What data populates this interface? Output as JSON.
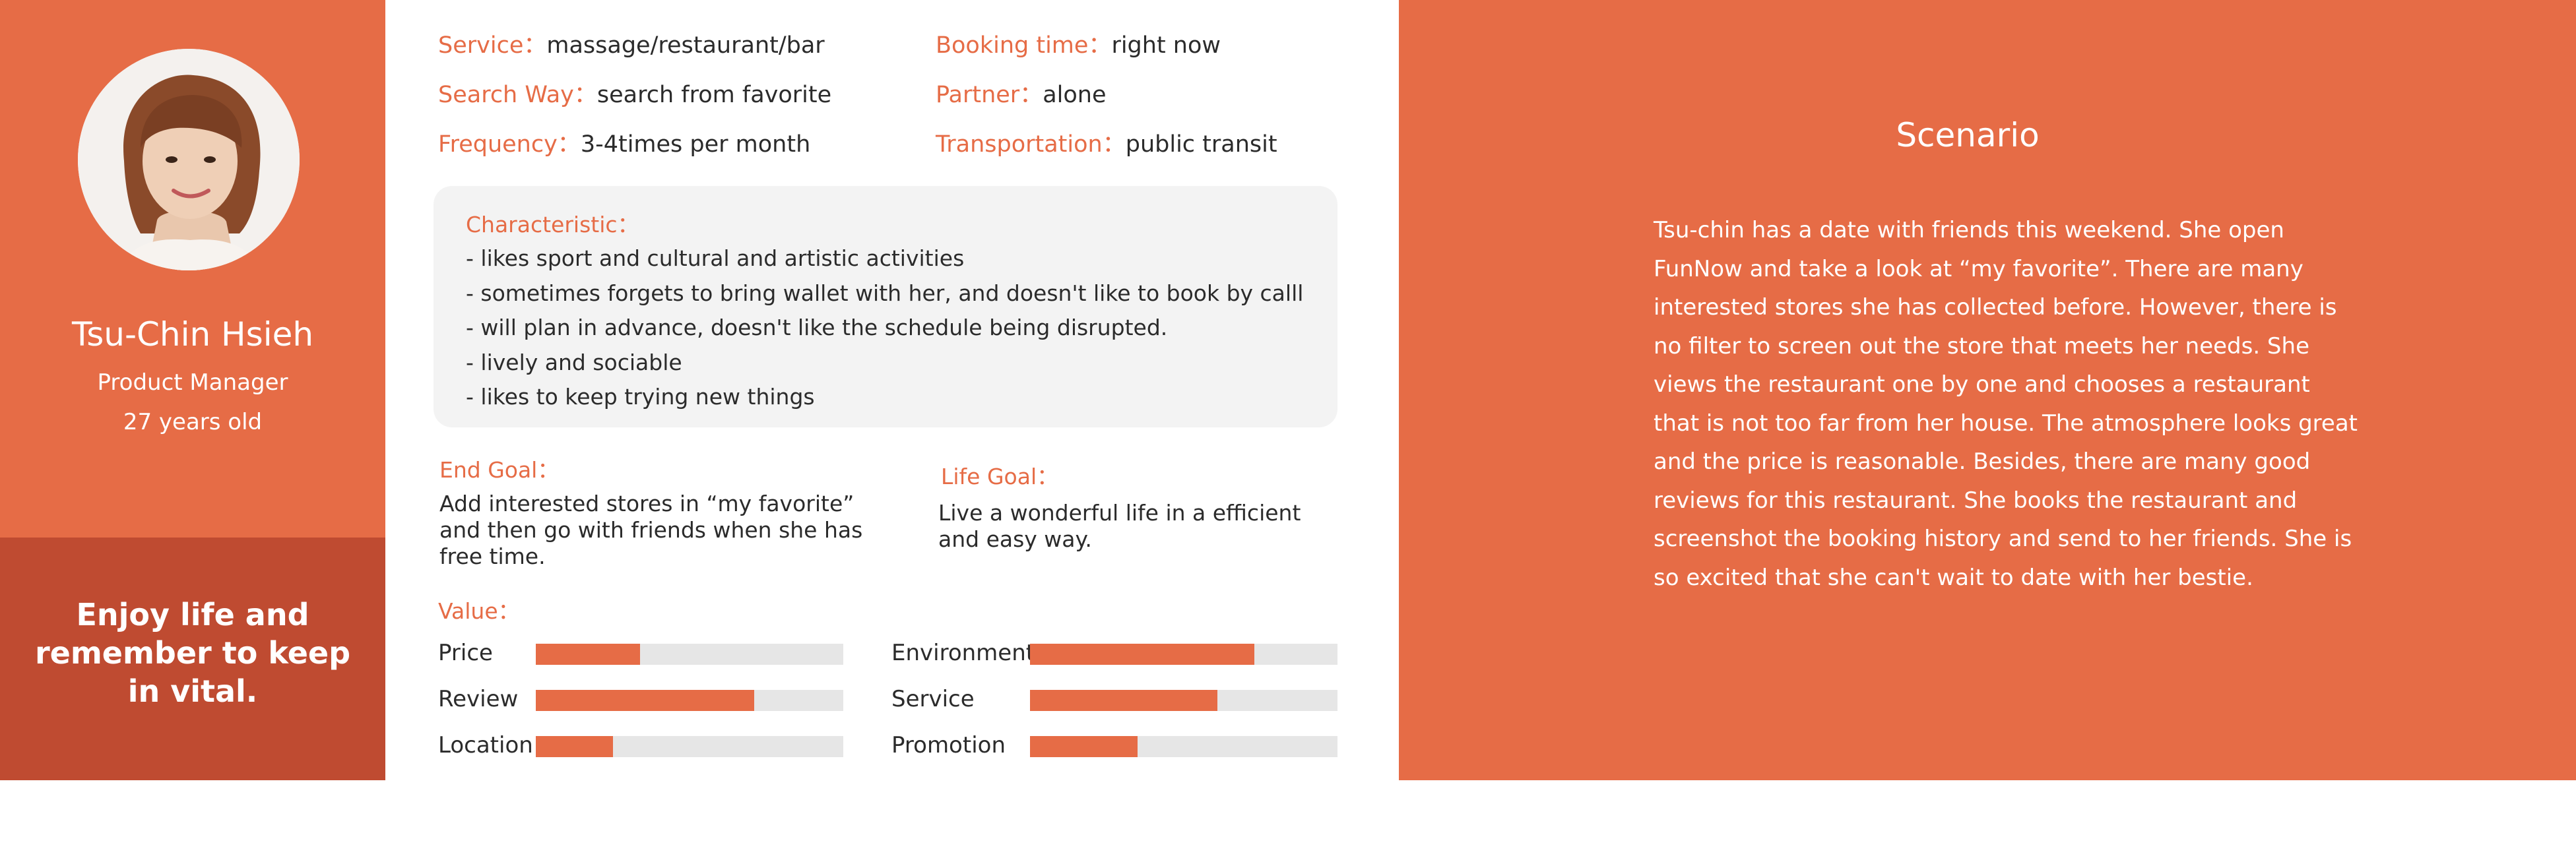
{
  "persona": {
    "name": "Tsu-Chin Hsieh",
    "role": "Product Manager",
    "age": "27 years old",
    "avatar_icon": "portrait-photo",
    "motto": "Enjoy life and remember to keep in vital."
  },
  "details": {
    "service": {
      "label": "Service：",
      "value": "massage/restaurant/bar"
    },
    "search_way": {
      "label": "Search Way：",
      "value": "search from favorite"
    },
    "frequency": {
      "label": "Frequency：",
      "value": "3-4times per month"
    },
    "booking_time": {
      "label": "Booking time：",
      "value": "right now"
    },
    "partner": {
      "label": "Partner：",
      "value": "alone"
    },
    "transportation": {
      "label": "Transportation：",
      "value": "public transit"
    }
  },
  "characteristic": {
    "title": "Characteristic：",
    "items": [
      "- likes sport and cultural and artistic activities",
      "- sometimes forgets to bring wallet with her, and doesn't like to book by calll",
      "- will plan in advance, doesn't like the schedule being disrupted.",
      "- lively and sociable",
      "- likes to keep trying new things"
    ]
  },
  "goals": {
    "end_goal": {
      "title": "End Goal：",
      "text": "Add interested stores in “my favorite” and then go with friends when she has free time."
    },
    "life_goal": {
      "title": "Life Goal：",
      "text": "Live a wonderful life in a efficient and easy way."
    }
  },
  "values": {
    "title": "Value：",
    "metrics": [
      {
        "label": "Price",
        "level": 0.34
      },
      {
        "label": "Review",
        "level": 0.71
      },
      {
        "label": "Location",
        "level": 0.25
      },
      {
        "label": "Environment",
        "level": 0.73
      },
      {
        "label": "Service",
        "level": 0.61
      },
      {
        "label": "Promotion",
        "level": 0.35
      }
    ]
  },
  "scenario": {
    "title": "Scenario",
    "text": "Tsu-chin has a date with friends this weekend. She open FunNow and take a look at “my favorite”. There are many interested stores she has collected before. However, there is no filter to screen out the store that meets her needs. She views the restaurant one by one and chooses a restaurant that is not too far from her house. The atmosphere looks great and the price is reasonable. Besides, there are many good reviews for this restaurant. She books the restaurant and screenshot the booking history and send to her friends. She is so excited that she can't wait to date with her bestie."
  },
  "colors": {
    "accent": "#e66c46",
    "accent_dark": "#bf4b31",
    "panel_gray": "#f3f3f3",
    "track_gray": "#e6e6e6"
  }
}
